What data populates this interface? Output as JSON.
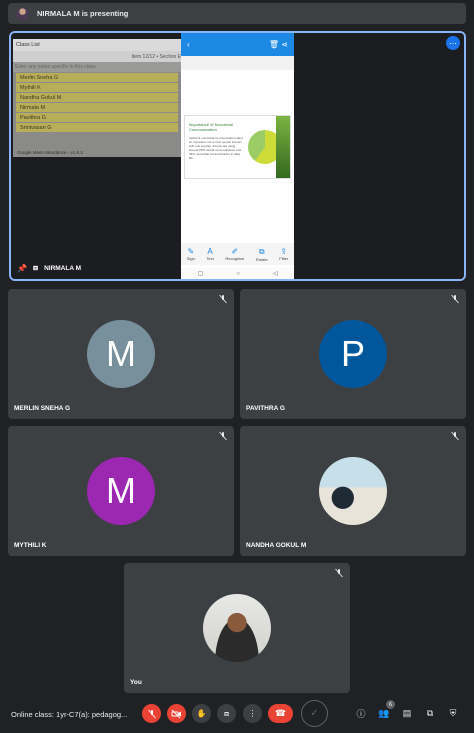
{
  "banner": {
    "text": "NIRMALA M is presenting"
  },
  "presentation": {
    "presenter_name": "NIRMALA M",
    "class_window": {
      "title": "Class List",
      "info": "Item 12/12 • Section E",
      "note": "Enter any notes specific to this class",
      "rows": [
        "Merlin Sneha G",
        "Mythili K",
        "Nandha Gokul M",
        "Nirmala M",
        "Pavithra G",
        "Srinivasan G"
      ],
      "footer": "Google Meet Attendance - v1.6.3"
    },
    "phone": {
      "slide_title": "Importance of Nonverbal Communication",
      "slide_body": "Verbal & nonverbal communication plays an important role to how people interact with one another. People are using around 65% verbal communication and 35% nonverbal communication in daily life.",
      "tools": [
        {
          "icon": "✎",
          "label": "Sign"
        },
        {
          "icon": "A",
          "label": "Text"
        },
        {
          "icon": "✐",
          "label": "Recognize"
        },
        {
          "icon": "⧉",
          "label": "Rotate"
        },
        {
          "icon": "⇪",
          "label": "Filter"
        }
      ],
      "nav": [
        "▢",
        "○",
        "◁"
      ]
    }
  },
  "participants": [
    {
      "name": "MERLIN SNEHA G",
      "initial": "M",
      "color": "#78909c"
    },
    {
      "name": "PAVITHRA G",
      "initial": "P",
      "color": "#01579b"
    },
    {
      "name": "MYTHILI K",
      "initial": "M",
      "color": "#9c27b0"
    },
    {
      "name": "NANDHA GOKUL M",
      "initial": "",
      "color": ""
    },
    {
      "name": "You",
      "initial": "",
      "color": ""
    }
  ],
  "controls": {
    "meeting_title": "Online class: 1yr-C7(a): pedagog...",
    "participant_count": "6"
  },
  "colors": {
    "accent": "#8ab4f8",
    "red": "#ea4335",
    "tile": "#3c4043"
  }
}
